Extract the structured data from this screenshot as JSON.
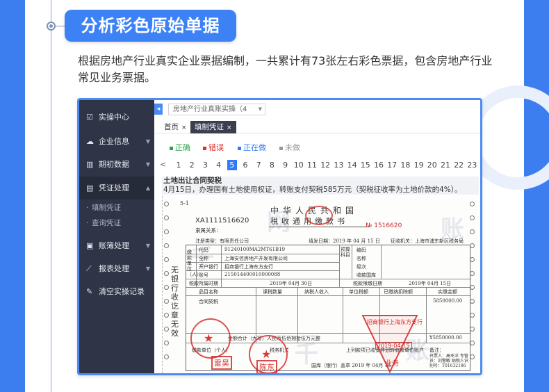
{
  "section": {
    "title": "分析彩色原始单据",
    "description": "根据房地产行业真实企业票据编制，一共累计有73张左右彩色票据，包含房地产行业常见业务票据。"
  },
  "app": {
    "sidebar": {
      "items": [
        {
          "label": "实操中心",
          "icon": "checklist-icon"
        },
        {
          "label": "企业信息",
          "icon": "cloud-icon"
        },
        {
          "label": "期初数据",
          "icon": "bar-chart-icon"
        },
        {
          "label": "凭证处理",
          "icon": "document-icon"
        },
        {
          "label": "账簿处理",
          "icon": "book-icon"
        },
        {
          "label": "报表处理",
          "icon": "line-chart-icon"
        },
        {
          "label": "清空实操记录",
          "icon": "brush-icon"
        }
      ],
      "subitems": [
        "填制凭证",
        "查询凭证"
      ]
    },
    "company_select": "房地产行业真账实操（4",
    "tabs": [
      {
        "label": "首页"
      },
      {
        "label": "填制凭证"
      }
    ],
    "legend": [
      {
        "label": "正确",
        "color": "#2aa34a"
      },
      {
        "label": "错误",
        "color": "#e02b2b"
      },
      {
        "label": "正在做",
        "color": "#2f7cf6"
      },
      {
        "label": "未做",
        "color": "#999999"
      }
    ],
    "pager": {
      "prev": "<",
      "pages": [
        "1",
        "2",
        "3",
        "4",
        "5",
        "6",
        "7",
        "8",
        "9",
        "10",
        "11",
        "12",
        "13",
        "14",
        "15",
        "16",
        "17",
        "18",
        "19",
        "20",
        "21",
        "22",
        "23"
      ],
      "current": "5"
    },
    "task": {
      "title": "土地出让合同契税",
      "detail": "4月15日，办理国有土地使用权证，转账支付契税585万元（契税征收率为土地价款的4%）。"
    }
  },
  "voucher": {
    "code": "5-1",
    "title_line1": "中华人民共和国",
    "title_line2": "税收通用缴款书",
    "serial": "XA1111516620",
    "number": "№ 1516620",
    "subordinate": "隶属关系：",
    "registration_type": "注册类型：有限责任公司",
    "fill_date": "填发日期：2019 年 04 月 15 日",
    "collecting_organ": "征收机关：上海市浦东新区税务局",
    "payer_side_label": "缴款单位（人）",
    "rows": [
      {
        "label": "代码",
        "value": "91240100MA2MT61B19"
      },
      {
        "label": "全称",
        "value": "上海安信房地产开发有限公司"
      },
      {
        "label": "开户银行",
        "value": "招商银行上海东方支行"
      },
      {
        "label": "账号",
        "value": "215014400010000088"
      }
    ],
    "budget_labels": [
      "编码",
      "名称",
      "级次"
    ],
    "budget_side_label": "预算科目",
    "treasury": "收款国库",
    "tax_period": "税款所属时期",
    "tax_period_value": "2019年 04月 30日",
    "tax_deadline": "税款限缴日期",
    "tax_deadline_value": "2019年 04月 15日",
    "headers": [
      "品目名称",
      "课税数量",
      "纳税人收入",
      "单位税额",
      "已缴纳扣除额",
      "实缴金额"
    ],
    "item_name": "合同契税",
    "amount": "5850000.00",
    "total_label": "金额合计（大写）人民币伍佰捌拾伍万元整",
    "total_value": "¥5850000.00",
    "side_text": "无银行收讫章无效",
    "bottom_labels": [
      "缴款单位（个人）",
      "税务机关",
      "上列款项已收妥并划转收款单位账户",
      "备注："
    ],
    "bottom_note": "国库（银行）盖章 2019 年 04月 15",
    "remark": "开票人：高冬洋 专管员：刘警敏 纳税人识别号：T01632186",
    "seal_names": [
      "雷昊",
      "陈东"
    ],
    "bank_stamp_text": "招商银行上海东方支行",
    "stamp_date": "2019-04-15",
    "stamp_business": "业务",
    "watermark": [
      "千",
      "网",
      "账",
      "千",
      "账"
    ]
  },
  "colors": {
    "accent": "#3c7ef0",
    "sidebar_bg": "#2f3547",
    "stamp_red": "#d72323"
  }
}
